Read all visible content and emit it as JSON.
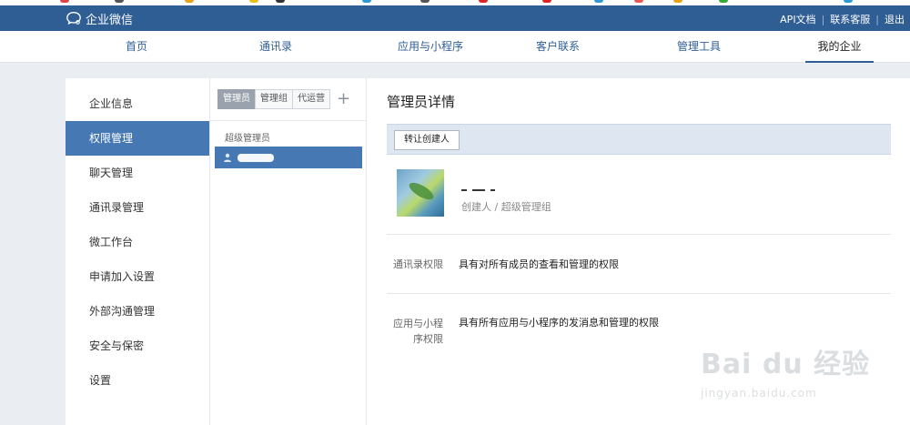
{
  "topbar": {
    "logo_text": "企业微信",
    "links": [
      "API文档",
      "联系客服",
      "退出"
    ]
  },
  "nav": {
    "items": [
      "首页",
      "通讯录",
      "应用与小程序",
      "客户联系",
      "管理工具",
      "我的企业"
    ],
    "active_index": 5
  },
  "sidebar": {
    "items": [
      "企业信息",
      "权限管理",
      "聊天管理",
      "通讯录管理",
      "微工作台",
      "申请加入设置",
      "外部沟通管理",
      "安全与保密",
      "设置"
    ],
    "active_index": 1
  },
  "admin_panel": {
    "tabs": [
      "管理员",
      "管理组",
      "代运营"
    ],
    "add_symbol": "+",
    "group_label": "超级管理员"
  },
  "detail": {
    "title": "管理员详情",
    "transfer_button": "转让创建人",
    "user_role": "创建人 / 超级管理组",
    "permissions": [
      {
        "label": "通讯录权限",
        "value": "具有对所有成员的查看和管理的权限"
      },
      {
        "label": "应用与小程序权限",
        "value": "具有所有应用与小程序的发消息和管理的权限"
      }
    ]
  },
  "watermark": {
    "main": "Bai du 经验",
    "sub": "jingyan.baidu.com"
  },
  "colors": {
    "topbar": "#2f5e95",
    "accent": "#4679b3",
    "action_bar": "#dde6f1"
  }
}
